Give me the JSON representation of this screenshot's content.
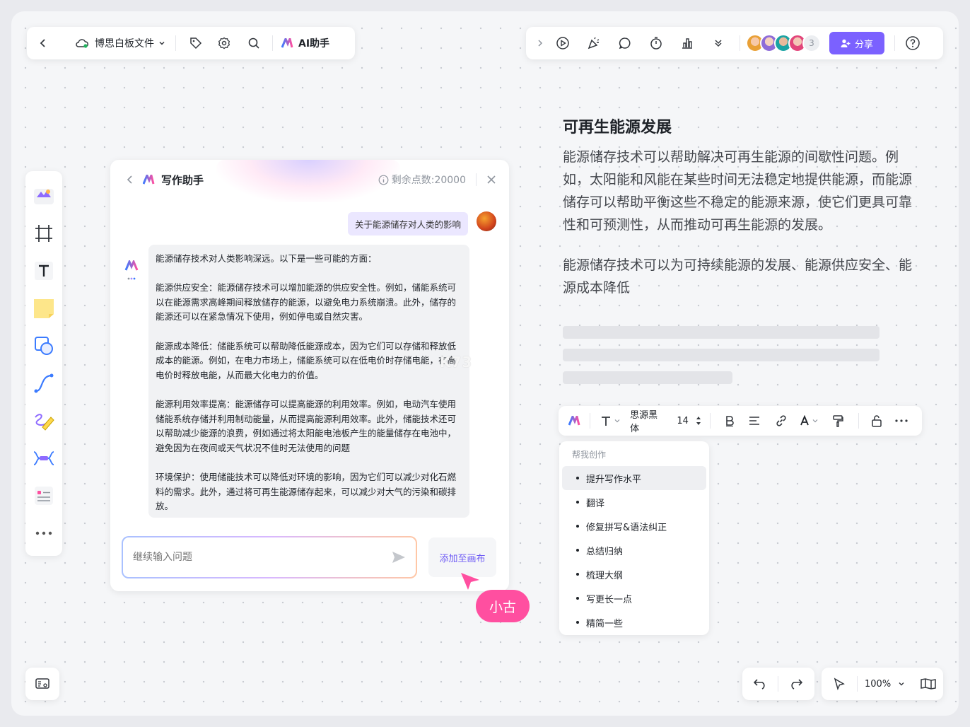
{
  "top_left": {
    "file_name": "博思白板文件",
    "ai_label": "AI助手"
  },
  "top_right": {
    "extra_collaborators": "3",
    "share_label": "分享",
    "accent": "#7b61ff"
  },
  "chat": {
    "title": "写作助手",
    "points": "剩余点数:20000",
    "user_prompt": "关于能源储存对人类的影响",
    "answer": [
      "能源储存技术对人类影响深远。以下是一些可能的方面：",
      "能源供应安全：能源储存技术可以增加能源的供应安全性。例如，储能系统可以在能源需求高峰期间释放储存的能源，以避免电力系统崩溃。此外，储存的能源还可以在紧急情况下使用，例如停电或自然灾害。",
      "能源成本降低：储能系统可以帮助降低能源成本，因为它们可以存储和释放低成本的能源。例如，在电力市场上，储能系统可以在低电价时存储电能，在高电价时释放电能，从而最大化电力的价值。",
      "能源利用效率提高：能源储存可以提高能源的利用效率。例如，电动汽车使用储能系统存储并利用制动能量，从而提高能源利用效率。此外，储能技术还可以帮助减少能源的浪费，例如通过将太阳能电池板产生的能量储存在电池中，避免因为在夜间或天气状况不佳时无法使用的问题",
      "环境保护：使用储能技术可以降低对环境的影响，因为它们可以减少对化石燃料的需求。此外，通过将可再生能源储存起来，可以减少对大气的污染和碳排放。"
    ],
    "input_placeholder": "继续输入问题",
    "add_to_canvas": "添加至画布"
  },
  "cursor_user": "小古",
  "doc": {
    "title": "可再生能源发展",
    "para1": "能源储存技术可以帮助解决可再生能源的间歇性问题。例如，太阳能和风能在某些时间无法稳定地提供能源，而能源储存可以帮助平衡这些不稳定的能源来源，使它们更具可靠性和可预测性，从而推动可再生能源的发展。",
    "para2": "能源储存技术可以为可持续能源的发展、能源供应安全、能源成本降低"
  },
  "format_bar": {
    "font": "思源黑体",
    "size": "14"
  },
  "ai_menu": {
    "header": "帮我创作",
    "items": [
      "提升写作水平",
      "翻译",
      "修复拼写&语法纠正",
      "总结归纳",
      "梳理大纲",
      "写更长一点",
      "精简一些"
    ]
  },
  "zoom": "100%"
}
